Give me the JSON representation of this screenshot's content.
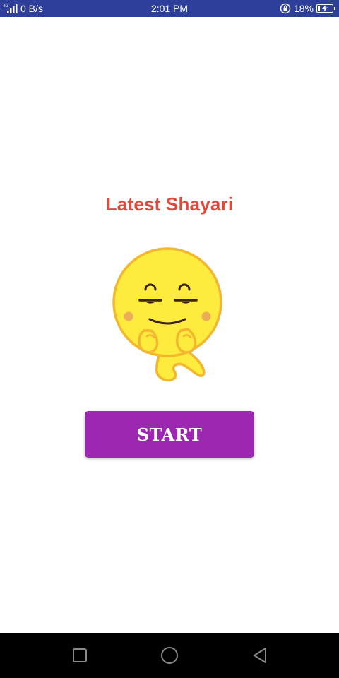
{
  "status_bar": {
    "network_label": "4G",
    "data_speed": "0 B/s",
    "time": "2:01 PM",
    "battery_percent": "18%",
    "battery_level": 0.18,
    "icons": [
      "signal-icon",
      "rotation-lock-icon",
      "battery-charging-icon"
    ]
  },
  "main": {
    "title": "Latest Shayari",
    "mascot_icon": "smug-emoji-icon",
    "start_label": "START"
  },
  "nav_bar": {
    "icons": [
      "recent-apps-icon",
      "home-icon",
      "back-icon"
    ]
  },
  "colors": {
    "status_bar_bg": "#2d3f9b",
    "title": "#e0483a",
    "start_button": "#9c27b0",
    "emoji_fill": "#fdeb3d",
    "emoji_outline": "#f3b62e"
  }
}
